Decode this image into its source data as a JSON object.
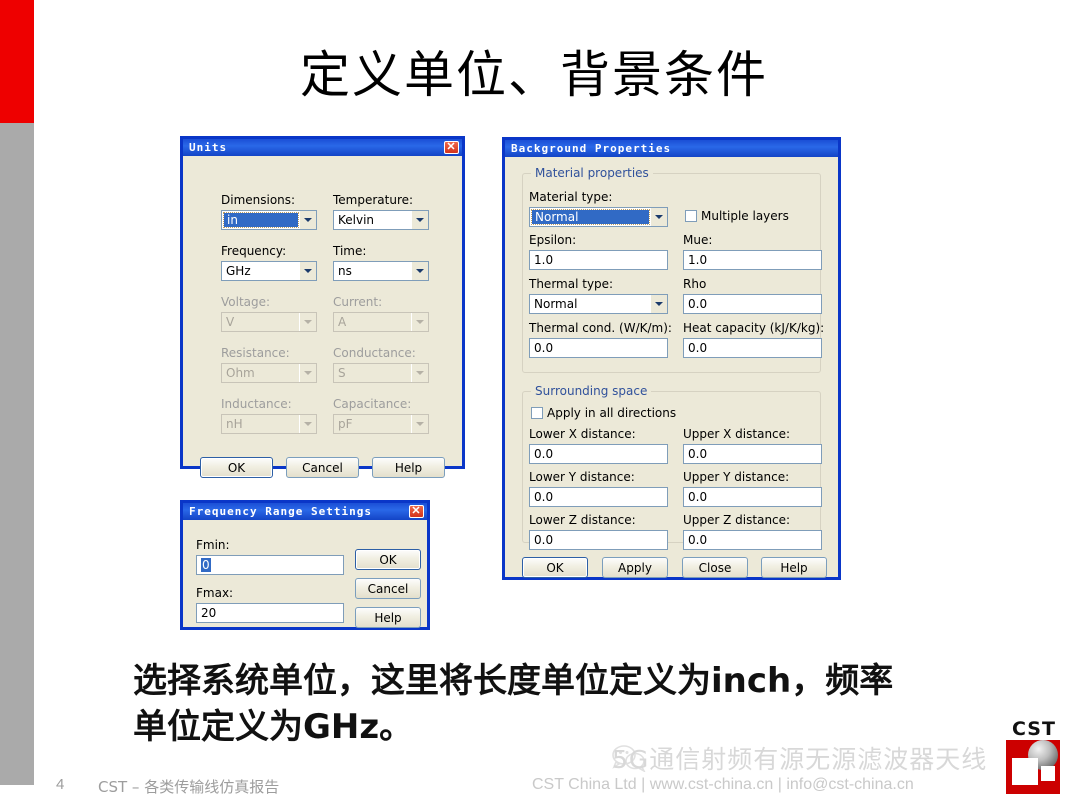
{
  "slide": {
    "title": "定义单位、背景条件",
    "body_line1": "选择系统单位，这里将长度单位定义为inch，频率",
    "body_line2": "单位定义为GHz。"
  },
  "footer": {
    "page_number": "4",
    "left_text": "CST – 各类传输线仿真报告",
    "right_text": "CST China Ltd | www.cst-china.cn | info@cst-china.cn",
    "watermark": "5G通信射频有源无源滤波器天线",
    "logo_text": "CST"
  },
  "units_dialog": {
    "title": "Units",
    "close_label": "✕",
    "fields": {
      "dimensions_label": "Dimensions:",
      "dimensions_value": "in",
      "temperature_label": "Temperature:",
      "temperature_value": "Kelvin",
      "frequency_label": "Frequency:",
      "frequency_value": "GHz",
      "time_label": "Time:",
      "time_value": "ns",
      "voltage_label": "Voltage:",
      "voltage_value": "V",
      "current_label": "Current:",
      "current_value": "A",
      "resistance_label": "Resistance:",
      "resistance_value": "Ohm",
      "conductance_label": "Conductance:",
      "conductance_value": "S",
      "inductance_label": "Inductance:",
      "inductance_value": "nH",
      "capacitance_label": "Capacitance:",
      "capacitance_value": "pF"
    },
    "buttons": {
      "ok": "OK",
      "cancel": "Cancel",
      "help": "Help"
    }
  },
  "background_dialog": {
    "title": "Background Properties",
    "material_group": "Material properties",
    "surrounding_group": "Surrounding space",
    "fields": {
      "material_type_label": "Material type:",
      "material_type_value": "Normal",
      "multiple_layers_label": "Multiple layers",
      "epsilon_label": "Epsilon:",
      "epsilon_value": "1.0",
      "mue_label": "Mue:",
      "mue_value": "1.0",
      "thermal_type_label": "Thermal type:",
      "thermal_type_value": "Normal",
      "rho_label": "Rho",
      "rho_value": "0.0",
      "thermal_cond_label": "Thermal cond. (W/K/m):",
      "thermal_cond_value": "0.0",
      "heat_capacity_label": "Heat capacity (kJ/K/kg):",
      "heat_capacity_value": "0.0",
      "apply_all_label": "Apply in all directions",
      "lower_x_label": "Lower X distance:",
      "lower_x_value": "0.0",
      "upper_x_label": "Upper X distance:",
      "upper_x_value": "0.0",
      "lower_y_label": "Lower Y distance:",
      "lower_y_value": "0.0",
      "upper_y_label": "Upper Y distance:",
      "upper_y_value": "0.0",
      "lower_z_label": "Lower Z distance:",
      "lower_z_value": "0.0",
      "upper_z_label": "Upper Z distance:",
      "upper_z_value": "0.0"
    },
    "buttons": {
      "ok": "OK",
      "apply": "Apply",
      "close": "Close",
      "help": "Help"
    }
  },
  "frequency_dialog": {
    "title": "Frequency Range Settings",
    "close_label": "✕",
    "fields": {
      "fmin_label": "Fmin:",
      "fmin_value": "0",
      "fmax_label": "Fmax:",
      "fmax_value": "20"
    },
    "buttons": {
      "ok": "OK",
      "cancel": "Cancel",
      "help": "Help"
    }
  },
  "colors": {
    "accent_red": "#ee0000",
    "sidebar_gray": "#aaaaaa",
    "dialog_border": "#0a36c8",
    "dialog_face": "#ece9d8",
    "selection_blue": "#316ac5"
  }
}
